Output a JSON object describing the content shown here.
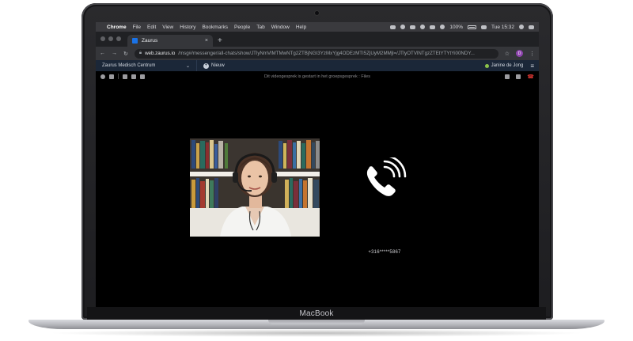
{
  "menubar": {
    "app_name": "Chrome",
    "items": [
      "File",
      "Edit",
      "View",
      "History",
      "Bookmarks",
      "People",
      "Tab",
      "Window",
      "Help"
    ],
    "battery": "100%",
    "clock": "Tue 15:32"
  },
  "browser": {
    "tab_title": "Zaurus",
    "tab_close": "×",
    "new_tab": "+",
    "url_host": "web.zaurus.io",
    "url_path": "/msg#/messenger/all-chats/show/JTlyNmVlMTMwNTg2ZTBjNGI3YzMxYjg4ODEzMTI5ZjUyM2MMjl=/JTlyOTVlNTgzZTEtYTYtYi00NDY...",
    "profile_initial": "D"
  },
  "app": {
    "org_name": "Zaurus Medisch Centrum",
    "new_label": "Nieuw",
    "user_name": "Janine de Jong",
    "status_color": "#8bc34a"
  },
  "call": {
    "notice": "Dit videogesprek is gestart in het groepsgesprek : Files",
    "caller_number": "+316*****5867",
    "hangup_color": "#e53935"
  },
  "laptop": {
    "brand": "MacBook"
  }
}
